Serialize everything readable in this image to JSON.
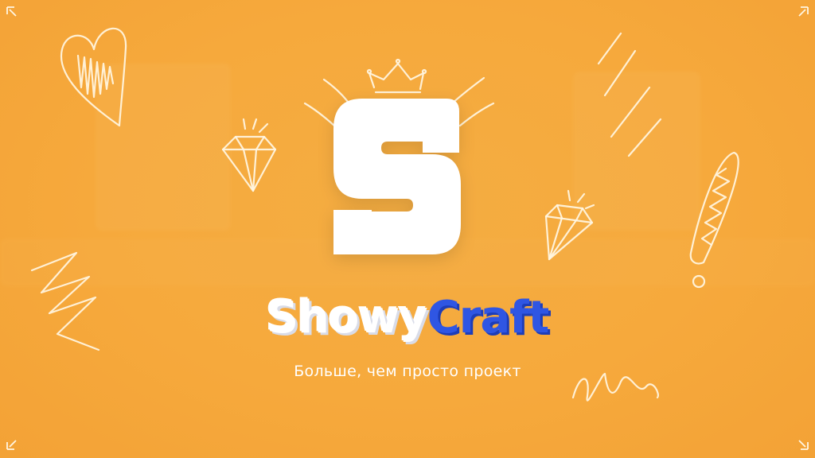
{
  "brand": {
    "name_part1": "Showy",
    "name_part2": "Craft",
    "logo_letter": "S"
  },
  "tagline": "Больше, чем просто проект",
  "colors": {
    "background": "#f6a93c",
    "accent_blue": "#2f56e3",
    "logo_white": "#ffffff"
  },
  "icons": [
    "crown-icon",
    "diamond-icon",
    "heart-icon",
    "exclamation-icon",
    "zigzag-icon",
    "corner-ornament-icon"
  ]
}
